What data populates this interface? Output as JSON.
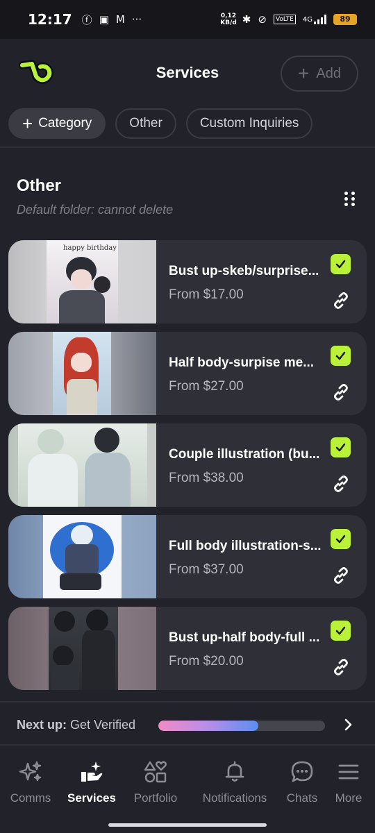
{
  "status_bar": {
    "time": "12:17",
    "net_speed_value": "0,12",
    "net_speed_unit": "KB/d",
    "network": "4G",
    "battery": "89"
  },
  "header": {
    "title": "Services",
    "add_label": "Add",
    "logo_color": "#b9f238"
  },
  "filters": {
    "category_label": "Category",
    "chips": [
      "Other",
      "Custom Inquiries"
    ]
  },
  "folder": {
    "title": "Other",
    "subtitle": "Default folder: cannot delete"
  },
  "services": [
    {
      "name": "Bust up-skeb/surprise...",
      "price": "From $17.00",
      "thumb_text": "happy birthday",
      "enabled": true
    },
    {
      "name": "Half body-surpise me...",
      "price": "From $27.00",
      "enabled": true
    },
    {
      "name": "Couple illustration (bu...",
      "price": "From $38.00",
      "enabled": true
    },
    {
      "name": "Full body illustration-s...",
      "price": "From $37.00",
      "enabled": true
    },
    {
      "name": "Bust up-half body-full ...",
      "price": "From $20.00",
      "enabled": true
    }
  ],
  "next_up": {
    "label": "Next up:",
    "value": "Get Verified",
    "progress_fraction": 0.6
  },
  "nav": {
    "items": [
      {
        "label": "Comms"
      },
      {
        "label": "Services"
      },
      {
        "label": "Portfolio"
      },
      {
        "label": "Notifications"
      },
      {
        "label": "Chats"
      },
      {
        "label": "More"
      }
    ],
    "active": "Services"
  },
  "colors": {
    "accent": "#b9f238",
    "background": "#22232a",
    "card": "#2e2f37"
  }
}
